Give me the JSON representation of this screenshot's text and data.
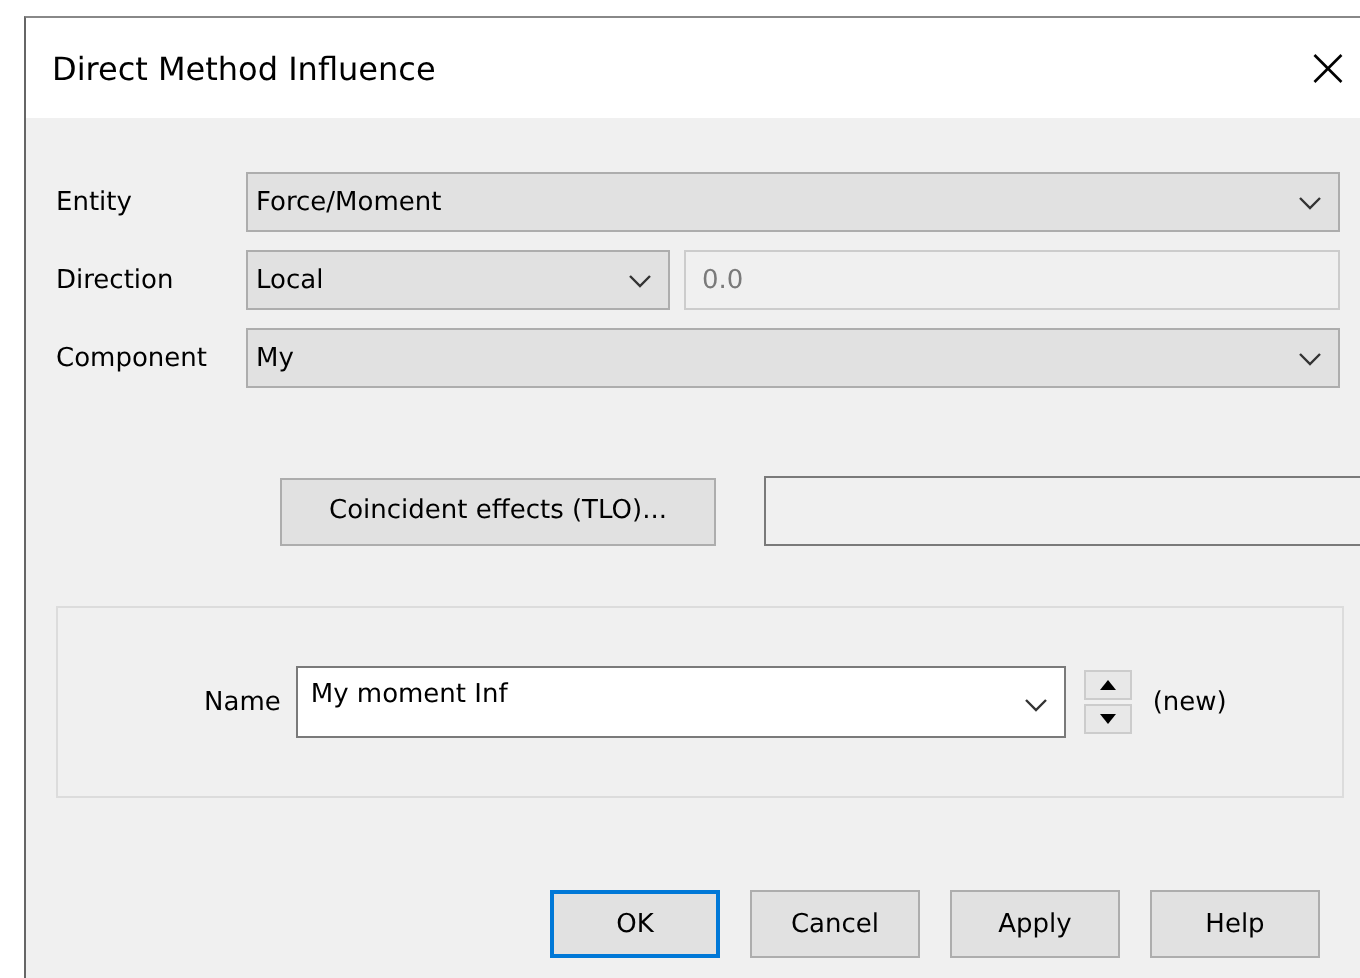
{
  "window": {
    "title": "Direct Method Influence",
    "close": "×"
  },
  "fields": [
    {
      "label": "Entity",
      "value": "Force/Moment"
    },
    {
      "label": "Direction",
      "value": "Local",
      "extra": {
        "value": "0.0",
        "disabled": true
      }
    },
    {
      "label": "Component",
      "value": "My"
    }
  ],
  "coincident": {
    "button": "Coincident effects (TLO)..."
  },
  "name": {
    "label": "Name",
    "value": "My moment Inf",
    "status": "(new)"
  },
  "buttons": [
    {
      "label": "OK",
      "default": true
    },
    {
      "label": "Cancel",
      "default": false
    },
    {
      "label": "Apply",
      "default": false
    },
    {
      "label": "Help",
      "default": false
    }
  ]
}
